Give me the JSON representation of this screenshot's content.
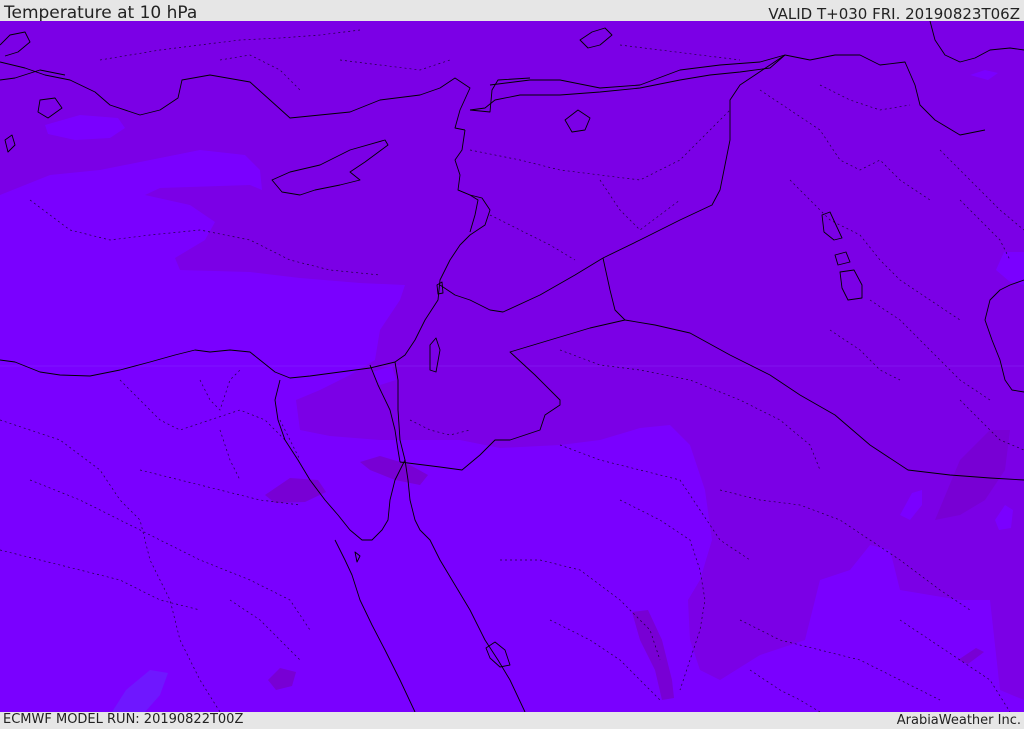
{
  "header": {
    "title": "Temperature at 10 hPa",
    "valid_time": "VALID T+030 FRI. 20190823T06Z"
  },
  "footer": {
    "model_run": "ECMWF MODEL RUN: 20190822T00Z",
    "provider": "ArabiaWeather Inc."
  },
  "colors": {
    "band_warm": "#7b00e6",
    "band_cool": "#7a00ff",
    "band_dark": "#7800d4",
    "band_blue": "#6f17ff",
    "border_line": "#000000",
    "frame_background": "#e6e6e6"
  }
}
